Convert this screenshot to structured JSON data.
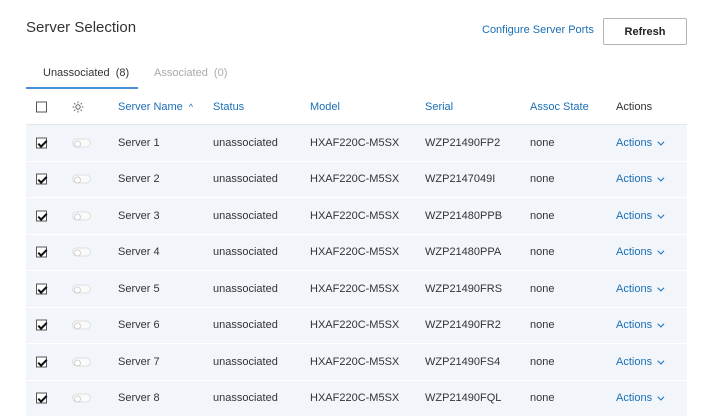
{
  "page": {
    "title": "Server Selection"
  },
  "toolbar": {
    "configure_link": "Configure Server Ports",
    "refresh_label": "Refresh"
  },
  "tabs": [
    {
      "label": "Unassociated  (8)",
      "active": true
    },
    {
      "label": "Associated  (0)",
      "active": false
    }
  ],
  "table": {
    "columns": {
      "name": "Server Name",
      "status": "Status",
      "model": "Model",
      "serial": "Serial",
      "assoc_state": "Assoc State",
      "actions": "Actions"
    },
    "rows": [
      {
        "name": "Server 1",
        "status": "unassociated",
        "model": "HXAF220C-M5SX",
        "serial": "WZP21490FP2",
        "assoc_state": "none",
        "actions": "Actions",
        "checked": true
      },
      {
        "name": "Server 2",
        "status": "unassociated",
        "model": "HXAF220C-M5SX",
        "serial": "WZP2147049I",
        "assoc_state": "none",
        "actions": "Actions",
        "checked": true
      },
      {
        "name": "Server 3",
        "status": "unassociated",
        "model": "HXAF220C-M5SX",
        "serial": "WZP21480PPB",
        "assoc_state": "none",
        "actions": "Actions",
        "checked": true
      },
      {
        "name": "Server 4",
        "status": "unassociated",
        "model": "HXAF220C-M5SX",
        "serial": "WZP21480PPA",
        "assoc_state": "none",
        "actions": "Actions",
        "checked": true
      },
      {
        "name": "Server 5",
        "status": "unassociated",
        "model": "HXAF220C-M5SX",
        "serial": "WZP21490FRS",
        "assoc_state": "none",
        "actions": "Actions",
        "checked": true
      },
      {
        "name": "Server 6",
        "status": "unassociated",
        "model": "HXAF220C-M5SX",
        "serial": "WZP21490FR2",
        "assoc_state": "none",
        "actions": "Actions",
        "checked": true
      },
      {
        "name": "Server 7",
        "status": "unassociated",
        "model": "HXAF220C-M5SX",
        "serial": "WZP21490FS4",
        "assoc_state": "none",
        "actions": "Actions",
        "checked": true
      },
      {
        "name": "Server 8",
        "status": "unassociated",
        "model": "HXAF220C-M5SX",
        "serial": "WZP21490FQL",
        "assoc_state": "none",
        "actions": "Actions",
        "checked": true
      }
    ]
  },
  "colors": {
    "accent": "#1b6fb5",
    "row_bg": "#f2f6fb",
    "tab_underline": "#4a90d9"
  },
  "icons": {
    "header_toggle": "sun-icon",
    "sort": "sort-ascending-icon",
    "row_actions": "chevron-down-icon"
  }
}
